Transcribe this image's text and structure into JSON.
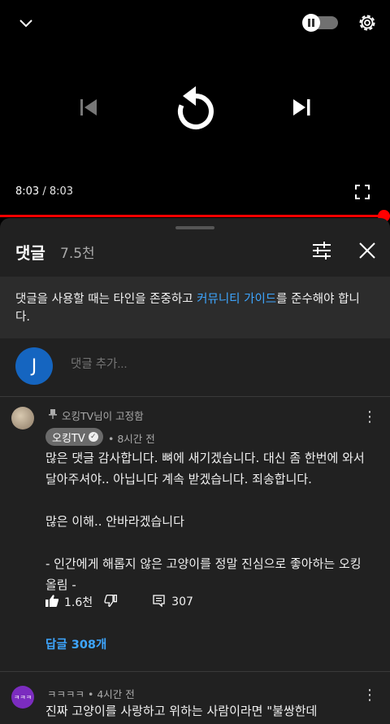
{
  "player": {
    "current_time": "8:03",
    "separator": " / ",
    "duration": "8:03",
    "progress_fraction": 1.0,
    "autoplay_toggle": "paused"
  },
  "comments_panel": {
    "title": "댓글",
    "count": "7.5천",
    "notice": {
      "prefix": "댓글을 사용할 때는 타인을 존중하고 ",
      "link": "커뮤니티 가이드",
      "suffix": "를 준수해야 합니다."
    },
    "input": {
      "avatar_letter": "J",
      "placeholder": "댓글 추가..."
    },
    "comments": [
      {
        "pinned_label": "오킹TV님이 고정함",
        "author": "오킹TV",
        "verified_mark": "✓",
        "time": "• 8시간 전",
        "text": "많은 댓글 감사합니다. 뼈에 새기겠습니다. 대신 좀 한번에 와서 달아주셔야.. 아닙니다 계속 받겠습니다. 죄송합니다.\n\n많은 이해.. 안바라겠습니다\n\n- 인간에게 해롭지 않은 고양이를 정말 진심으로 좋아하는 오킹 올림 -",
        "likes": "1.6천",
        "reply_count": "307",
        "replies_link": "답글 308개"
      },
      {
        "avatar_text": "ㅋㅋㅋ",
        "author": "ㅋㅋㅋㅋ",
        "time": "• 4시간 전",
        "text": "진짜 고양이를 사랑하고 위하는 사람이라면 \"불쌍한데"
      }
    ]
  },
  "colors": {
    "accent_red": "#ff0000",
    "link_blue": "#3ea6ff",
    "sheet_bg": "#212121",
    "notice_bg": "#2c2c2c"
  },
  "icons": [
    "chevron-down-icon",
    "pause-icon",
    "settings-gear-icon",
    "previous-track-icon",
    "replay-icon",
    "next-track-icon",
    "fullscreen-icon",
    "filter-sort-icon",
    "close-icon",
    "pin-icon",
    "verified-icon",
    "thumbs-up-icon",
    "thumbs-down-icon",
    "reply-icon",
    "more-vert-icon"
  ]
}
